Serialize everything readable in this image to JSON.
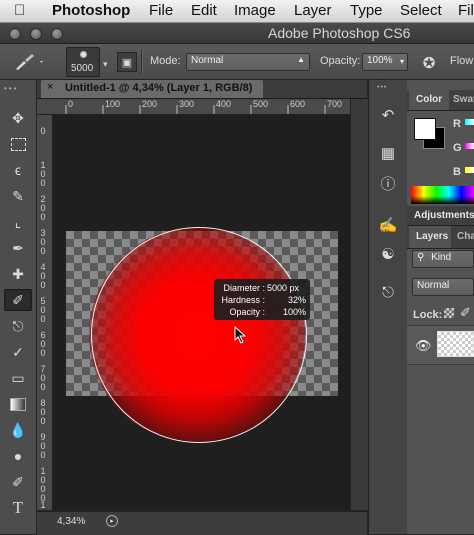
{
  "menubar": {
    "app_name": "Photoshop",
    "items": [
      "File",
      "Edit",
      "Image",
      "Layer",
      "Type",
      "Select",
      "Filt"
    ]
  },
  "titlebar": {
    "title": "Adobe Photoshop CS6"
  },
  "options": {
    "brush_size": "5000",
    "mode_label": "Mode:",
    "mode_value": "Normal",
    "opacity_label": "Opacity:",
    "opacity_value": "100%",
    "flow_label": "Flow:"
  },
  "document": {
    "tab_title": "Untitled-1 @ 4,34% (Layer 1, RGB/8)",
    "close_glyph": "×",
    "zoom": "4,34%"
  },
  "ruler": {
    "top": [
      "0",
      "100",
      "200",
      "300",
      "400",
      "500",
      "600",
      "700"
    ],
    "left": [
      "0",
      "100",
      "200",
      "300",
      "400",
      "500",
      "600",
      "700",
      "800",
      "900",
      "1000",
      "1100"
    ]
  },
  "brush_tooltip": {
    "diameter_label": "Diameter :",
    "diameter_value": "5000 px",
    "hardness_label": "Hardness :",
    "hardness_value": "32%",
    "opacity_label": "Opacity :",
    "opacity_value": "100%"
  },
  "panels": {
    "color_tab": "Color",
    "swatches_tab": "Swat",
    "rgb_labels": [
      "R",
      "G",
      "B"
    ],
    "adjustments_tab": "Adjustments",
    "layers_tab": "Layers",
    "channels_tab": "Cha",
    "kind_filter": "Kind",
    "blend_mode": "Normal",
    "lock_label": "Lock:"
  },
  "colors": {
    "brush_color": "#ff0000",
    "foreground": "#ffffff",
    "background": "#000000"
  }
}
